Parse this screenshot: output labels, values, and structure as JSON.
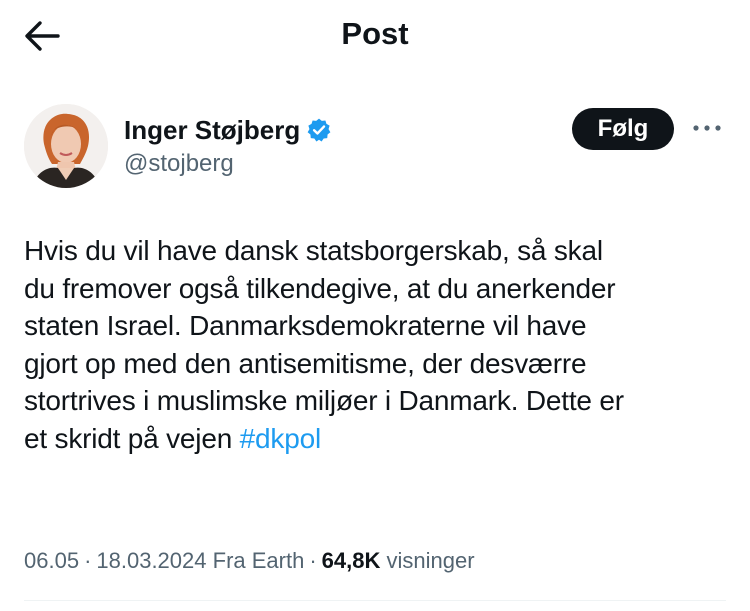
{
  "header": {
    "back_icon": "arrow-left-icon",
    "title": "Post"
  },
  "author": {
    "avatar_icon": "avatar-photo",
    "name": "Inger Støjberg",
    "verified_icon": "verified-badge-icon",
    "verified_color": "#1d9bf0",
    "handle": "@stojberg",
    "follow_label": "Følg",
    "more_icon": "more-dots-icon"
  },
  "tweet": {
    "lines": [
      "Hvis du vil have dansk statsborgerskab, så skal",
      "du fremover også tilkendegive, at du anerkender",
      "staten Israel. Danmarksdemokraterne vil have",
      "gjort op med den antisemitisme, der desværre",
      "stortrives i muslimske miljøer i Danmark. Dette er"
    ],
    "last_line_prefix": "et skridt på vejen",
    "hashtag": "#dkpol",
    "hashtag_color": "#1d9bf0"
  },
  "meta": {
    "time": "06.05",
    "separator": "·",
    "date": "18.03.2024",
    "source": "Fra Earth",
    "views_count": "64,8K",
    "views_label": "visninger"
  },
  "colors": {
    "text": "#0f1419",
    "secondary": "#536471",
    "button_bg": "#0f1419",
    "divider": "#eff3f4"
  }
}
